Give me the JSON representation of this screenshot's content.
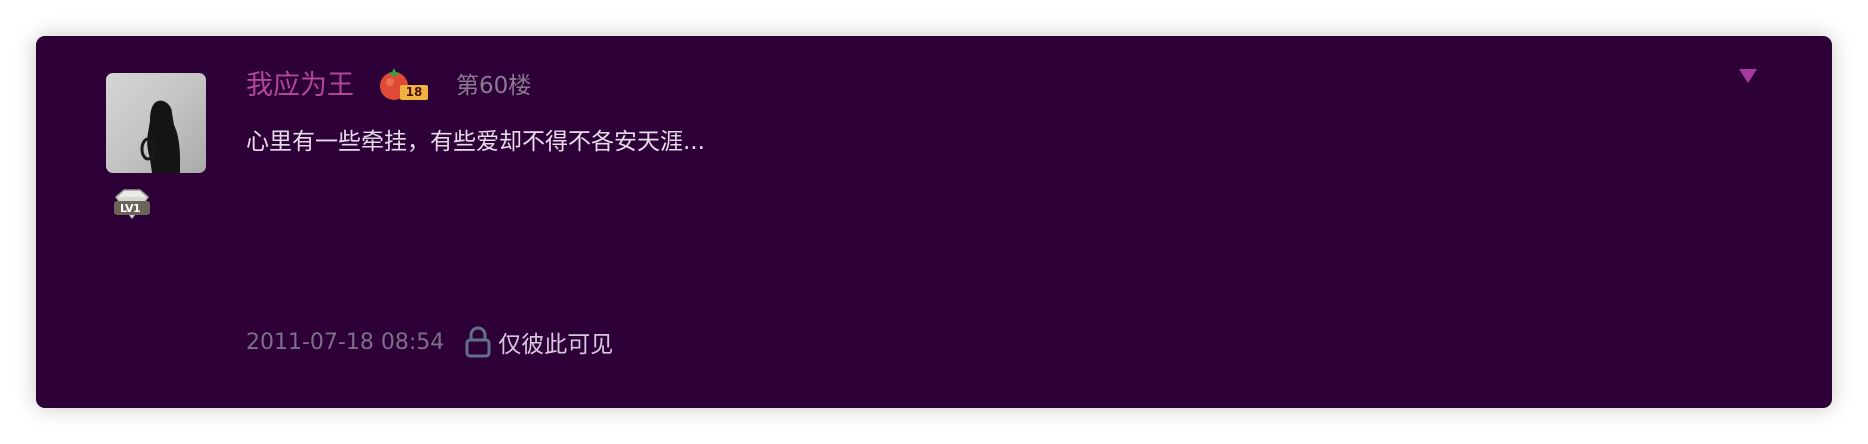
{
  "colors": {
    "card_background": "#2d0038",
    "username": "#b1479a",
    "floor": "#8a7a92",
    "content": "#e8dcea",
    "timestamp": "#7e6f88",
    "visibility_text": "#d7c9dd",
    "dropdown_arrow": "#a63aa2"
  },
  "post": {
    "author": {
      "name": "我应为王",
      "avatar_icon": "user-avatar-silhouette",
      "level_badge": {
        "icon": "diamond-icon",
        "label": "LV1"
      },
      "rank_badge": {
        "icon": "tomato-icon",
        "value": "18"
      }
    },
    "floor": "第60楼",
    "content": "心里有一些牵挂，有些爱却不得不各安天涯...",
    "timestamp": "2011-07-18 08:54",
    "visibility": {
      "icon": "lock-icon",
      "label": "仅彼此可见"
    },
    "menu_icon": "dropdown-triangle-icon"
  }
}
